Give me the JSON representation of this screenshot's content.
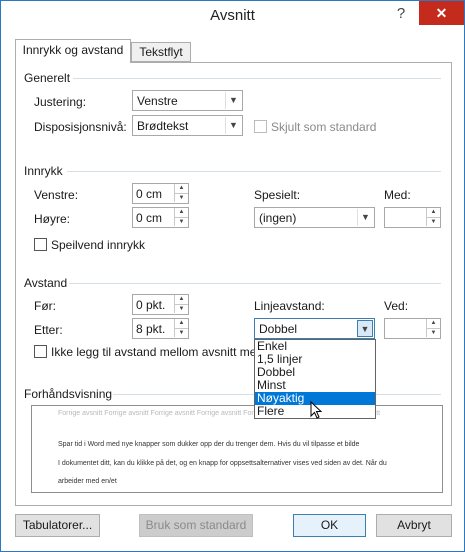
{
  "dialog": {
    "title": "Avsnitt",
    "help": "?",
    "close": "✕"
  },
  "tabs": [
    "Innrykk og avstand",
    "Tekstflyt"
  ],
  "general": {
    "section_title": "Generelt",
    "alignment_label": "Justering:",
    "alignment_value": "Venstre",
    "outline_label": "Disposisjonsnivå:",
    "outline_value": "Brødtekst",
    "collapsed_label": "Skjult som standard"
  },
  "indent": {
    "section_title": "Innrykk",
    "left_label": "Venstre:",
    "left_value": "0 cm",
    "right_label": "Høyre:",
    "right_value": "0 cm",
    "special_label": "Spesielt:",
    "special_value": "(ingen)",
    "by_label": "Med:",
    "by_value": "",
    "mirror_label": "Speilvend innrykk"
  },
  "spacing": {
    "section_title": "Avstand",
    "before_label": "Før:",
    "before_value": "0 pkt.",
    "after_label": "Etter:",
    "after_value": "8 pkt.",
    "line_label": "Linjeavstand:",
    "line_value": "Dobbel",
    "at_label": "Ved:",
    "at_value": "",
    "dont_add_label": "Ikke legg til avstand mellom avsnitt med",
    "options": [
      "Enkel",
      "1,5 linjer",
      "Dobbel",
      "Minst",
      "Nøyaktig",
      "Flere"
    ],
    "selected_option": "Nøyaktig"
  },
  "preview": {
    "section_title": "Forhåndsvisning",
    "previous_text": "Forrige avsnitt Forrige avsnitt Forrige avsnitt Forrige avsnitt Forrige avsnitt Forrige avsnitt Forrige avsnitt",
    "line1": "Spar tid i Word med nye knapper som dukker opp der du trenger dem. Hvis du vil tilpasse et bilde",
    "line2": "I dokumentet ditt, kan du klikke på det, og en knapp for oppsettsalternativer vises ved siden av det. Når du",
    "line3": "arbeider med en/et"
  },
  "buttons": {
    "tabs": "Tabulatorer...",
    "default": "Bruk som standard",
    "ok": "OK",
    "cancel": "Avbryt"
  }
}
